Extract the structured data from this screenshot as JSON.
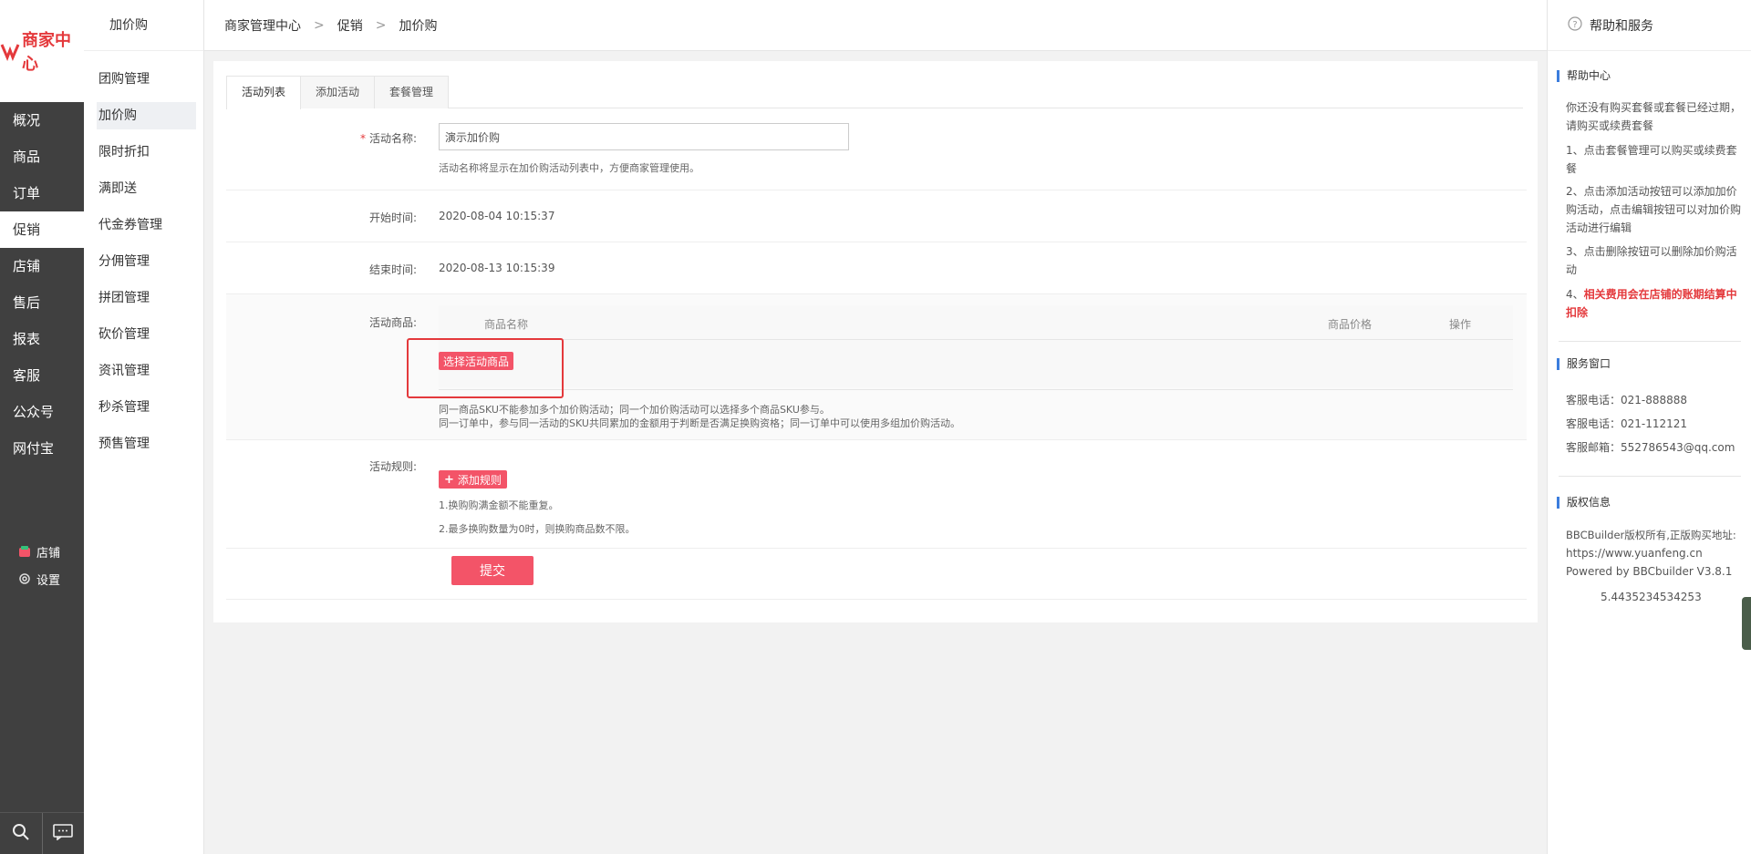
{
  "logo": {
    "text": "商家中心"
  },
  "left_nav": {
    "items": [
      {
        "label": "概况"
      },
      {
        "label": "商品"
      },
      {
        "label": "订单"
      },
      {
        "label": "促销"
      },
      {
        "label": "店铺"
      },
      {
        "label": "售后"
      },
      {
        "label": "报表"
      },
      {
        "label": "客服"
      },
      {
        "label": "公众号"
      },
      {
        "label": "网付宝"
      }
    ],
    "bottom": {
      "shop": "店铺",
      "settings": "设置"
    }
  },
  "sub_nav": {
    "title": "加价购",
    "items": [
      {
        "label": "团购管理"
      },
      {
        "label": "加价购"
      },
      {
        "label": "限时折扣"
      },
      {
        "label": "满即送"
      },
      {
        "label": "代金券管理"
      },
      {
        "label": "分佣管理"
      },
      {
        "label": "拼团管理"
      },
      {
        "label": "砍价管理"
      },
      {
        "label": "资讯管理"
      },
      {
        "label": "秒杀管理"
      },
      {
        "label": "预售管理"
      }
    ]
  },
  "breadcrumb": {
    "home": "商家管理中心",
    "level1": "促销",
    "level2": "加价购",
    "sep": ">"
  },
  "tabs": [
    {
      "label": "活动列表"
    },
    {
      "label": "添加活动"
    },
    {
      "label": "套餐管理"
    }
  ],
  "form": {
    "name_label": "活动名称:",
    "name_required": "*",
    "name_value": "演示加价购",
    "name_hint": "活动名称将显示在加价购活动列表中，方便商家管理使用。",
    "start_label": "开始时间:",
    "start_value": "2020-08-04 10:15:37",
    "end_label": "结束时间:",
    "end_value": "2020-08-13 10:15:39",
    "goods_label": "活动商品:",
    "goods_col_name": "商品名称",
    "goods_col_price": "商品价格",
    "goods_col_action": "操作",
    "select_goods_button": "选择活动商品",
    "goods_note_1": "同一商品SKU不能参加多个加价购活动；同一个加价购活动可以选择多个商品SKU参与。",
    "goods_note_2": "同一订单中，参与同一活动的SKU共同累加的金额用于判断是否满足换购资格；同一订单中可以使用多组加价购活动。",
    "rule_label": "活动规则:",
    "add_rule_button": "添加规则",
    "rule_note_1": "1.换购购满金额不能重复。",
    "rule_note_2": "2.最多换购数量为0时，则换购商品数不限。",
    "submit_button": "提交"
  },
  "help": {
    "title": "帮助和服务",
    "center_title": "帮助中心",
    "center_intro": "你还没有购买套餐或套餐已经过期，请购买或续费套餐",
    "center_1": "1、点击套餐管理可以购买或续费套餐",
    "center_2": "2、点击添加活动按钮可以添加加价购活动，点击编辑按钮可以对加价购活动进行编辑",
    "center_3": "3、点击删除按钮可以删除加价购活动",
    "center_4_prefix": "4、",
    "center_4_red": "相关费用会在店铺的账期结算中扣除",
    "service_title": "服务窗口",
    "phone1": "客服电话：021-888888",
    "phone2": "客服电话：021-112121",
    "email": "客服邮箱：552786543@qq.com",
    "copyright_title": "版权信息",
    "copyright_1": "BBCBuilder版权所有,正版购买地址:",
    "copyright_url": "https://www.yuanfeng.cn",
    "copyright_2": "Powered by BBCbuilder V3.8.1",
    "copyright_3": "5.4435234534253"
  },
  "colors": {
    "accent": "#f35468",
    "sidebar": "#404040",
    "highlight": "#e4393c",
    "section_marker": "#3b7ddd"
  }
}
